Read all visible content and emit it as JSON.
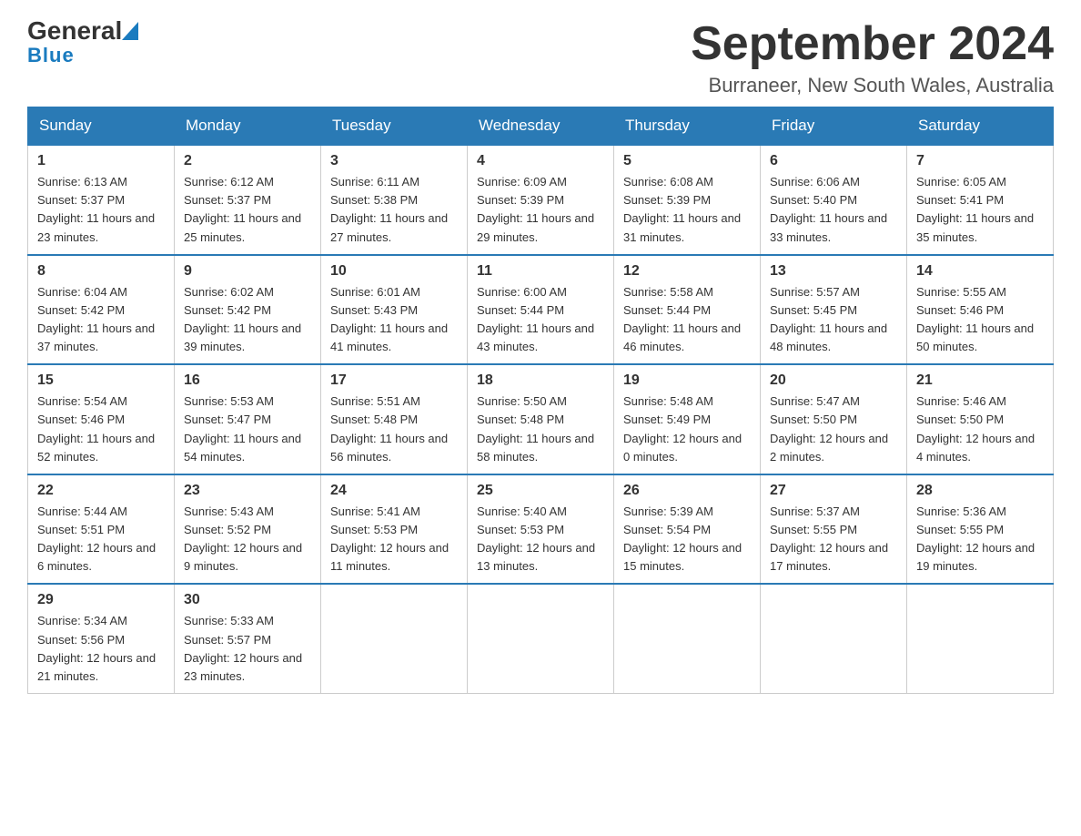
{
  "header": {
    "logo_general": "General",
    "logo_blue": "Blue",
    "title": "September 2024",
    "location": "Burraneer, New South Wales, Australia"
  },
  "days_of_week": [
    "Sunday",
    "Monday",
    "Tuesday",
    "Wednesday",
    "Thursday",
    "Friday",
    "Saturday"
  ],
  "weeks": [
    [
      {
        "day": "1",
        "sunrise": "Sunrise: 6:13 AM",
        "sunset": "Sunset: 5:37 PM",
        "daylight": "Daylight: 11 hours and 23 minutes."
      },
      {
        "day": "2",
        "sunrise": "Sunrise: 6:12 AM",
        "sunset": "Sunset: 5:37 PM",
        "daylight": "Daylight: 11 hours and 25 minutes."
      },
      {
        "day": "3",
        "sunrise": "Sunrise: 6:11 AM",
        "sunset": "Sunset: 5:38 PM",
        "daylight": "Daylight: 11 hours and 27 minutes."
      },
      {
        "day": "4",
        "sunrise": "Sunrise: 6:09 AM",
        "sunset": "Sunset: 5:39 PM",
        "daylight": "Daylight: 11 hours and 29 minutes."
      },
      {
        "day": "5",
        "sunrise": "Sunrise: 6:08 AM",
        "sunset": "Sunset: 5:39 PM",
        "daylight": "Daylight: 11 hours and 31 minutes."
      },
      {
        "day": "6",
        "sunrise": "Sunrise: 6:06 AM",
        "sunset": "Sunset: 5:40 PM",
        "daylight": "Daylight: 11 hours and 33 minutes."
      },
      {
        "day": "7",
        "sunrise": "Sunrise: 6:05 AM",
        "sunset": "Sunset: 5:41 PM",
        "daylight": "Daylight: 11 hours and 35 minutes."
      }
    ],
    [
      {
        "day": "8",
        "sunrise": "Sunrise: 6:04 AM",
        "sunset": "Sunset: 5:42 PM",
        "daylight": "Daylight: 11 hours and 37 minutes."
      },
      {
        "day": "9",
        "sunrise": "Sunrise: 6:02 AM",
        "sunset": "Sunset: 5:42 PM",
        "daylight": "Daylight: 11 hours and 39 minutes."
      },
      {
        "day": "10",
        "sunrise": "Sunrise: 6:01 AM",
        "sunset": "Sunset: 5:43 PM",
        "daylight": "Daylight: 11 hours and 41 minutes."
      },
      {
        "day": "11",
        "sunrise": "Sunrise: 6:00 AM",
        "sunset": "Sunset: 5:44 PM",
        "daylight": "Daylight: 11 hours and 43 minutes."
      },
      {
        "day": "12",
        "sunrise": "Sunrise: 5:58 AM",
        "sunset": "Sunset: 5:44 PM",
        "daylight": "Daylight: 11 hours and 46 minutes."
      },
      {
        "day": "13",
        "sunrise": "Sunrise: 5:57 AM",
        "sunset": "Sunset: 5:45 PM",
        "daylight": "Daylight: 11 hours and 48 minutes."
      },
      {
        "day": "14",
        "sunrise": "Sunrise: 5:55 AM",
        "sunset": "Sunset: 5:46 PM",
        "daylight": "Daylight: 11 hours and 50 minutes."
      }
    ],
    [
      {
        "day": "15",
        "sunrise": "Sunrise: 5:54 AM",
        "sunset": "Sunset: 5:46 PM",
        "daylight": "Daylight: 11 hours and 52 minutes."
      },
      {
        "day": "16",
        "sunrise": "Sunrise: 5:53 AM",
        "sunset": "Sunset: 5:47 PM",
        "daylight": "Daylight: 11 hours and 54 minutes."
      },
      {
        "day": "17",
        "sunrise": "Sunrise: 5:51 AM",
        "sunset": "Sunset: 5:48 PM",
        "daylight": "Daylight: 11 hours and 56 minutes."
      },
      {
        "day": "18",
        "sunrise": "Sunrise: 5:50 AM",
        "sunset": "Sunset: 5:48 PM",
        "daylight": "Daylight: 11 hours and 58 minutes."
      },
      {
        "day": "19",
        "sunrise": "Sunrise: 5:48 AM",
        "sunset": "Sunset: 5:49 PM",
        "daylight": "Daylight: 12 hours and 0 minutes."
      },
      {
        "day": "20",
        "sunrise": "Sunrise: 5:47 AM",
        "sunset": "Sunset: 5:50 PM",
        "daylight": "Daylight: 12 hours and 2 minutes."
      },
      {
        "day": "21",
        "sunrise": "Sunrise: 5:46 AM",
        "sunset": "Sunset: 5:50 PM",
        "daylight": "Daylight: 12 hours and 4 minutes."
      }
    ],
    [
      {
        "day": "22",
        "sunrise": "Sunrise: 5:44 AM",
        "sunset": "Sunset: 5:51 PM",
        "daylight": "Daylight: 12 hours and 6 minutes."
      },
      {
        "day": "23",
        "sunrise": "Sunrise: 5:43 AM",
        "sunset": "Sunset: 5:52 PM",
        "daylight": "Daylight: 12 hours and 9 minutes."
      },
      {
        "day": "24",
        "sunrise": "Sunrise: 5:41 AM",
        "sunset": "Sunset: 5:53 PM",
        "daylight": "Daylight: 12 hours and 11 minutes."
      },
      {
        "day": "25",
        "sunrise": "Sunrise: 5:40 AM",
        "sunset": "Sunset: 5:53 PM",
        "daylight": "Daylight: 12 hours and 13 minutes."
      },
      {
        "day": "26",
        "sunrise": "Sunrise: 5:39 AM",
        "sunset": "Sunset: 5:54 PM",
        "daylight": "Daylight: 12 hours and 15 minutes."
      },
      {
        "day": "27",
        "sunrise": "Sunrise: 5:37 AM",
        "sunset": "Sunset: 5:55 PM",
        "daylight": "Daylight: 12 hours and 17 minutes."
      },
      {
        "day": "28",
        "sunrise": "Sunrise: 5:36 AM",
        "sunset": "Sunset: 5:55 PM",
        "daylight": "Daylight: 12 hours and 19 minutes."
      }
    ],
    [
      {
        "day": "29",
        "sunrise": "Sunrise: 5:34 AM",
        "sunset": "Sunset: 5:56 PM",
        "daylight": "Daylight: 12 hours and 21 minutes."
      },
      {
        "day": "30",
        "sunrise": "Sunrise: 5:33 AM",
        "sunset": "Sunset: 5:57 PM",
        "daylight": "Daylight: 12 hours and 23 minutes."
      },
      null,
      null,
      null,
      null,
      null
    ]
  ]
}
